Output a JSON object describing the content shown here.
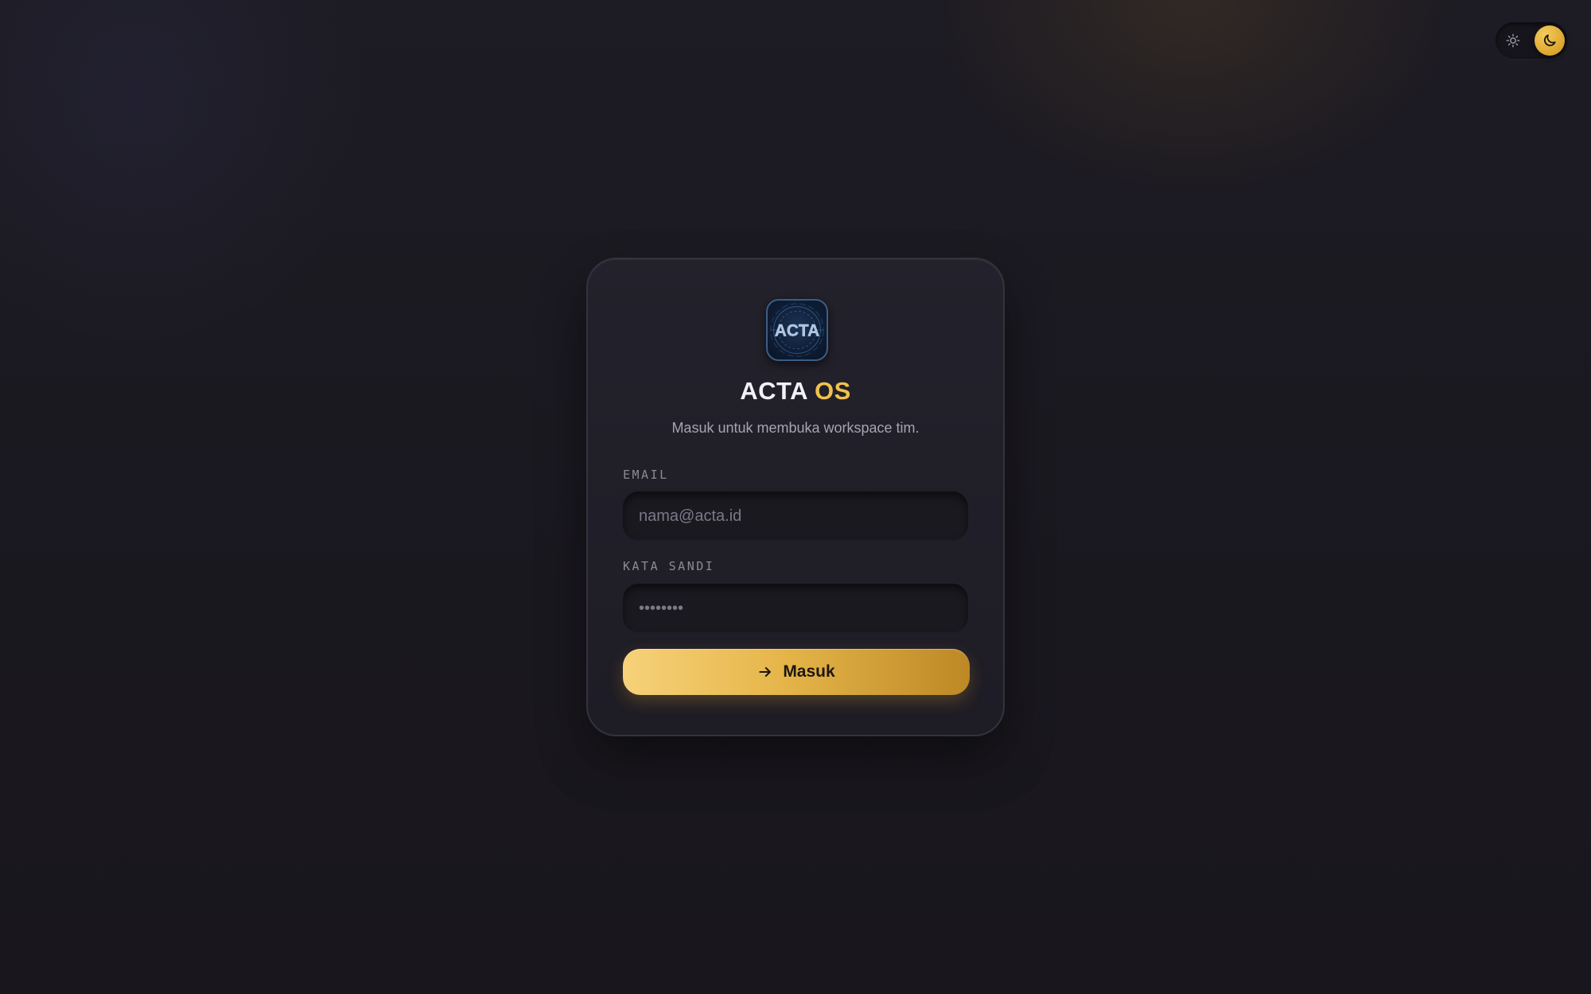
{
  "theme_toggle": {
    "light_icon": "sun-icon",
    "dark_icon": "moon-icon",
    "active": "dark",
    "accent": "#e3ad35"
  },
  "card": {
    "logo_text": "ACTA",
    "title_main": "ACTA",
    "title_accent": "OS",
    "subtitle": "Masuk untuk membuka workspace tim.",
    "accent_color": "#f0c24b"
  },
  "form": {
    "email": {
      "label": "EMAIL",
      "placeholder": "nama@acta.id",
      "value": ""
    },
    "password": {
      "label": "KATA SANDI",
      "placeholder": "••••••••",
      "value": ""
    },
    "submit": {
      "label": "Masuk",
      "icon": "arrow-right-icon"
    }
  }
}
